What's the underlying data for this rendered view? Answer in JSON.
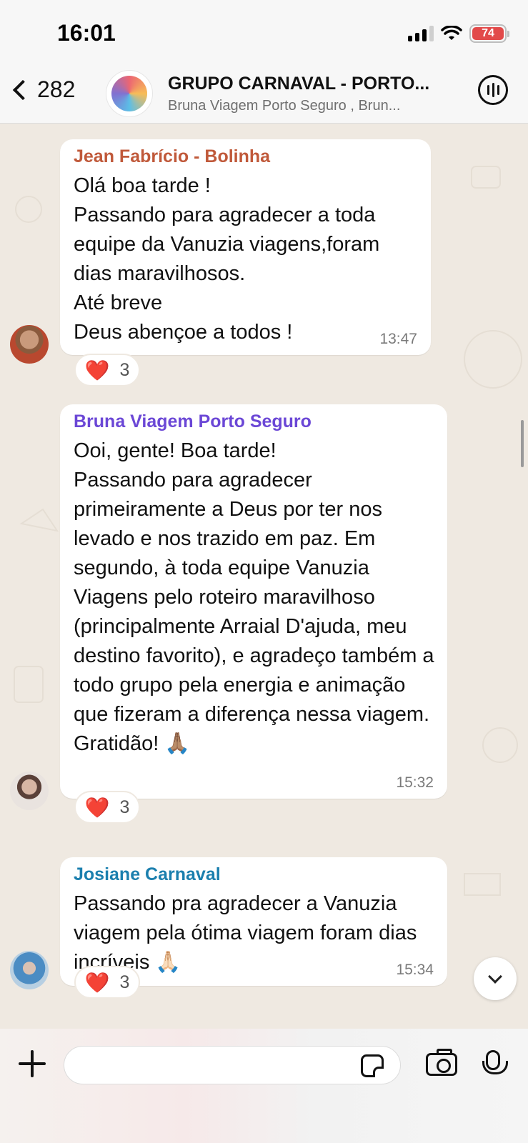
{
  "status_bar": {
    "time": "16:01",
    "battery": "74"
  },
  "header": {
    "back_count": "282",
    "group_title": "GRUPO CARNAVAL - PORTO...",
    "group_subtitle": "Bruna Viagem Porto Seguro , Brun..."
  },
  "messages": [
    {
      "sender": "Jean Fabrício - Bolinha",
      "sender_color": "#c0593a",
      "text": "Olá boa tarde !\nPassando para agradecer a toda equipe da Vanuzia viagens,foram dias maravilhosos.\nAté breve\nDeus abençoe a todos !",
      "time": "13:47",
      "reaction_emoji": "❤️",
      "reaction_count": "3"
    },
    {
      "sender": "Bruna Viagem Porto Seguro",
      "sender_color": "#6b47d6",
      "text": "Ooi, gente! Boa tarde!\nPassando para agradecer primeiramente a Deus por ter nos levado e nos trazido em paz. Em segundo, à toda equipe Vanuzia Viagens pelo roteiro maravilhoso (principalmente Arraial D'ajuda, meu destino favorito), e agradeço também a todo grupo pela energia e animação que fizeram a diferença nessa viagem.\nGratidão! 🙏🏽",
      "time": "15:32",
      "reaction_emoji": "❤️",
      "reaction_count": "3"
    },
    {
      "sender": "Josiane Carnaval",
      "sender_color": "#1b7fae",
      "text": "Passando pra agradecer a Vanuzia viagem pela ótima viagem foram dias incríveis 🙏🏻",
      "time": "15:34",
      "reaction_emoji": "❤️",
      "reaction_count": "3"
    }
  ],
  "composer": {
    "placeholder": ""
  },
  "icons": {
    "back": "chevron-left-icon",
    "call": "call-waveform-icon",
    "add": "plus-icon",
    "sticker": "sticker-icon",
    "camera": "camera-icon",
    "mic": "microphone-icon",
    "scroll_down": "chevron-down-icon"
  }
}
